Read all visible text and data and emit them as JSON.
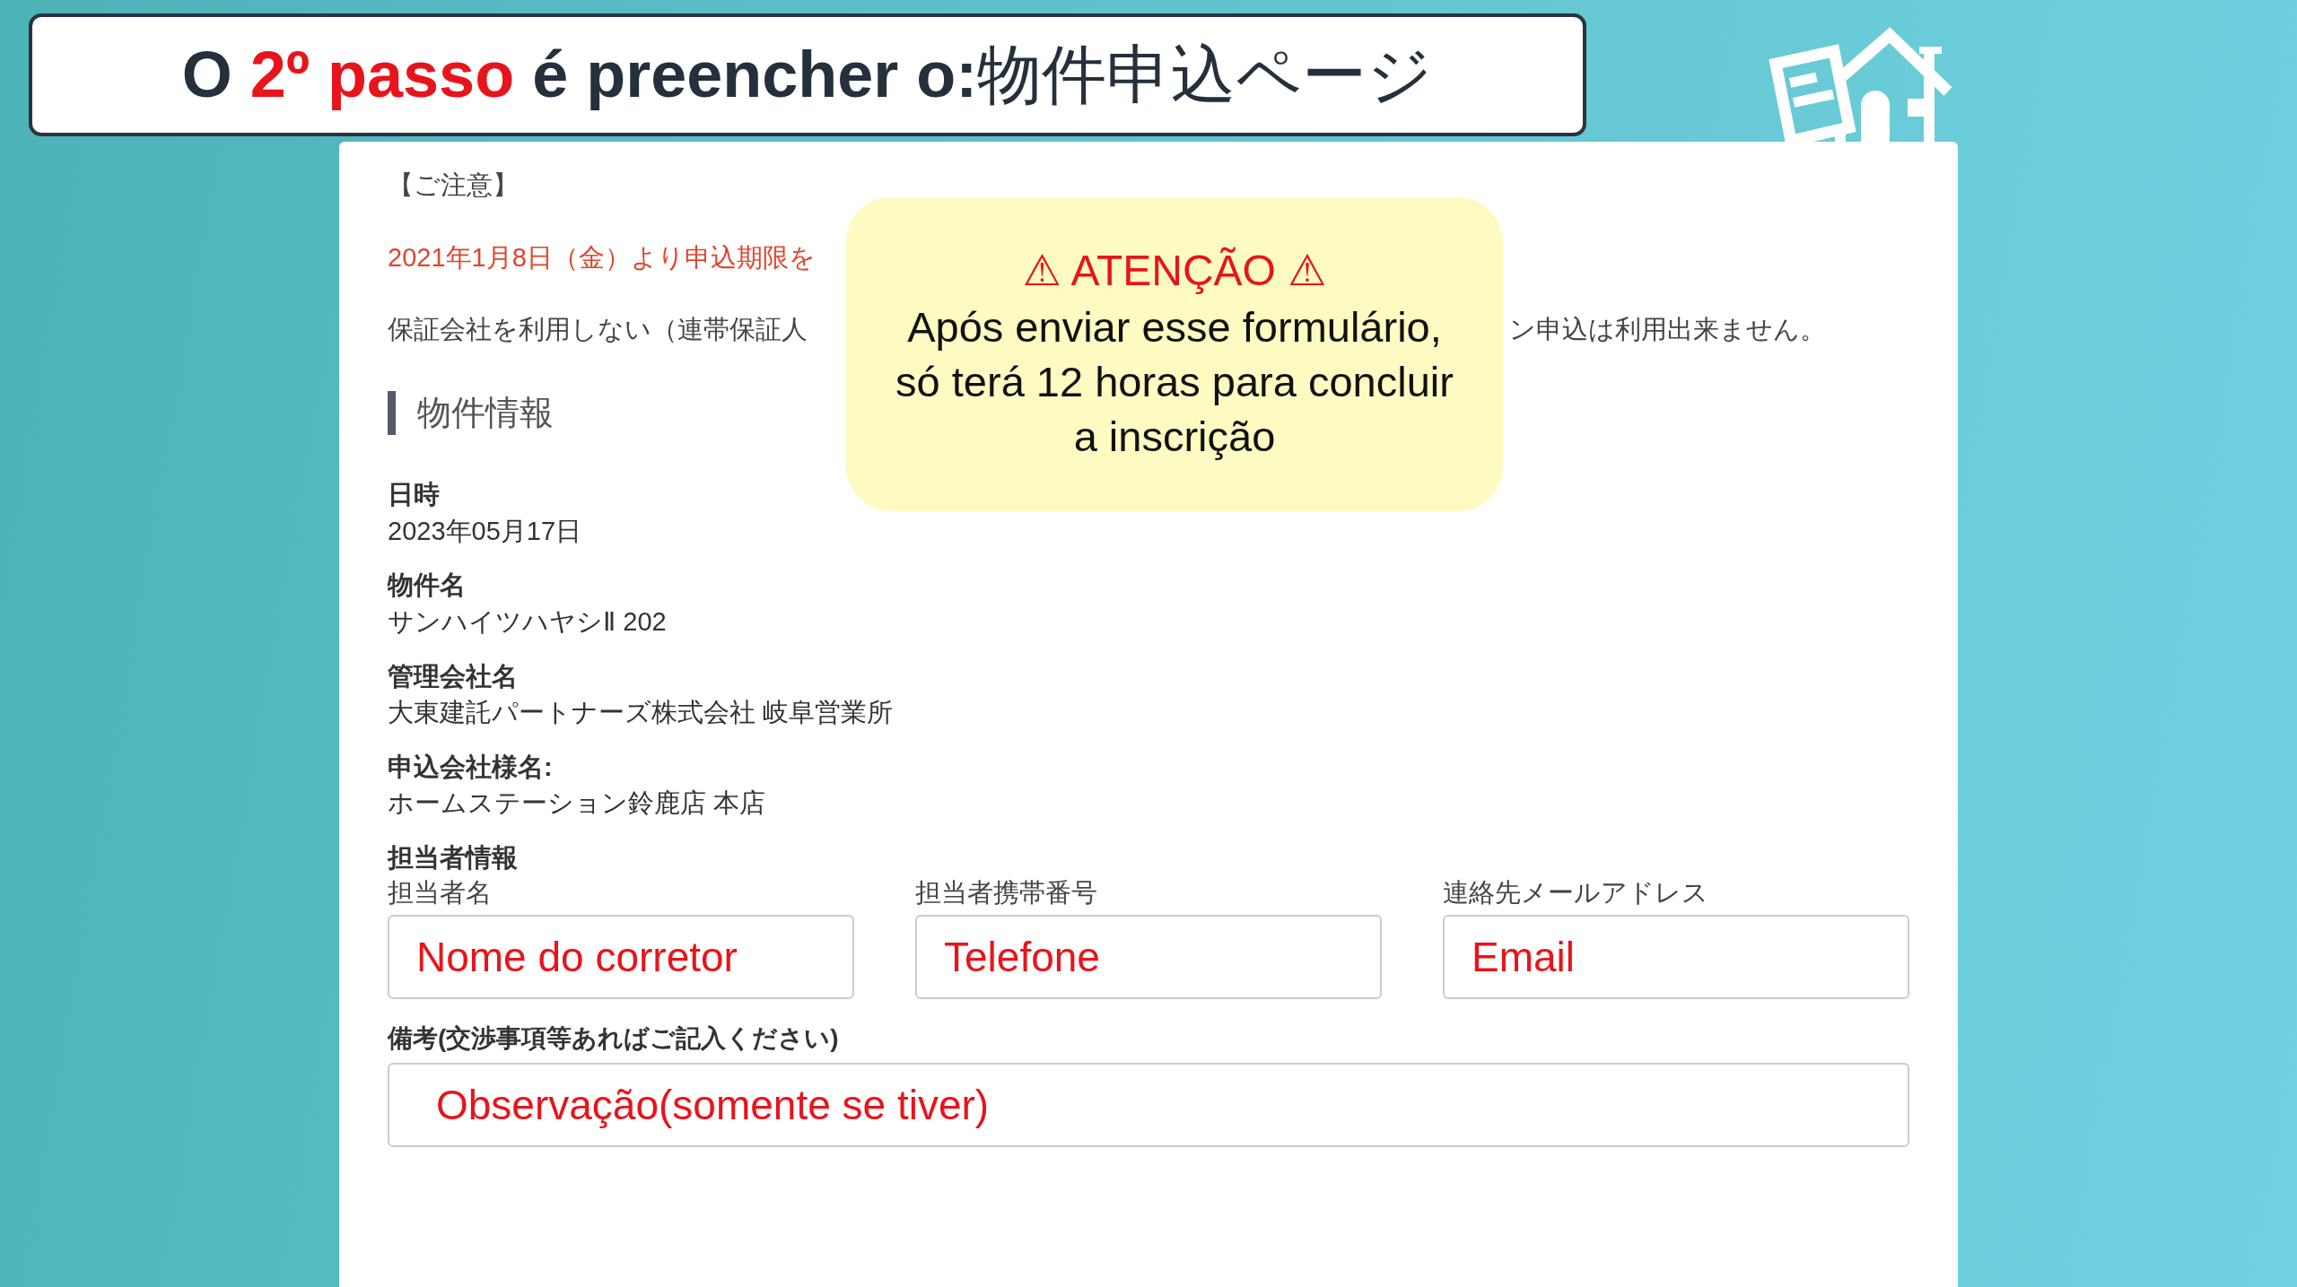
{
  "banner": {
    "title_parts": [
      {
        "kind": "plain",
        "text": "O "
      },
      {
        "kind": "highlight",
        "text": "2º passo"
      },
      {
        "kind": "plain",
        "text": " é preencher o:"
      },
      {
        "kind": "serif",
        "text": "物件申込ページ"
      }
    ]
  },
  "callout": {
    "heading": "⚠ ATENÇÃO ⚠",
    "body_lines": [
      "Após enviar esse formulário,",
      "só terá 12 horas para concluir",
      "a inscrição"
    ]
  },
  "notice": {
    "title": "【ご注意】",
    "deadline_line": "2021年1月8日（金）より申込期限を",
    "guarantor_line_start": "保証会社を利用しない（連帯保証人",
    "guarantor_line_end": "ン申込は利用出来ません。"
  },
  "section": {
    "heading": "物件情報"
  },
  "info": [
    {
      "label": "日時",
      "value": "2023年05月17日"
    },
    {
      "label": "物件名",
      "value": "サンハイツハヤシⅡ 202"
    },
    {
      "label": "管理会社名",
      "value": "大東建託パートナーズ株式会社 岐阜営業所"
    },
    {
      "label": "申込会社様名:",
      "value": "ホームステーション鈴鹿店 本店"
    }
  ],
  "contact": {
    "heading": "担当者情報",
    "fields": [
      {
        "label": "担当者名",
        "value": "Nome do corretor"
      },
      {
        "label": "担当者携帯番号",
        "value": "Telefone"
      },
      {
        "label": "連絡先メールアドレス",
        "value": "Email"
      }
    ]
  },
  "remarks": {
    "label": "備考(交渉事項等あればご記入ください)",
    "value": "Observação(somente se tiver)"
  }
}
